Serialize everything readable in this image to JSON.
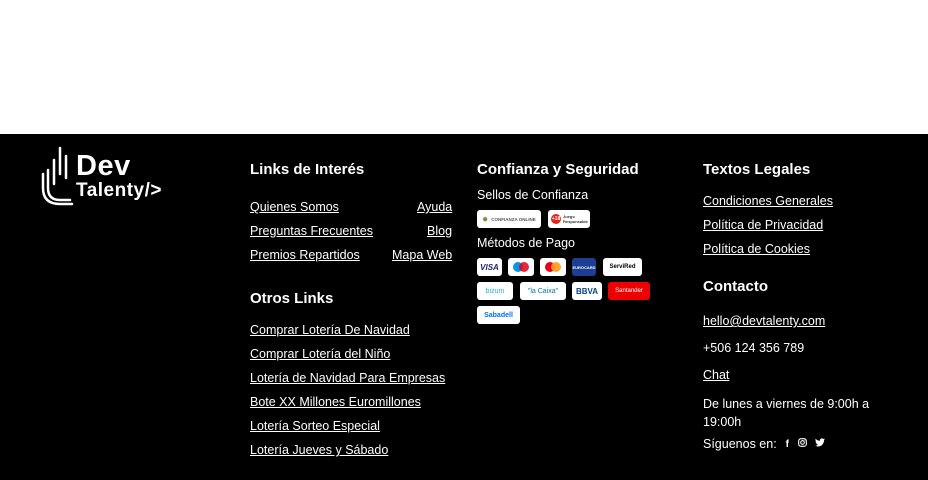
{
  "brand": {
    "line1": "Dev",
    "line2": "Talenty/>"
  },
  "links_interes": {
    "title": "Links de Interés",
    "left": [
      "Quienes Somos",
      "Preguntas Frecuentes",
      "Premios Repartidos"
    ],
    "right": [
      "Ayuda",
      "Blog",
      "Mapa Web"
    ]
  },
  "otros_links": {
    "title": "Otros Links",
    "items": [
      "Comprar Lotería De Navidad",
      "Comprar Lotería del Niño",
      "Lotería de Navidad Para Empresas",
      "Bote XX Millones Euromillones",
      "Lotería Sorteo Especial",
      "Lotería Jueves y Sábado"
    ]
  },
  "confianza": {
    "title": "Confianza y Seguridad",
    "sellos_label": "Sellos de Confianza",
    "sellos": [
      "CONFIANZA ONLINE",
      "Juego Responsable"
    ],
    "pago_label": "Métodos de Pago",
    "pagos": [
      "VISA",
      "Maestro",
      "Mastercard",
      "EUROCARD",
      "ServiRed",
      "bizum",
      "\"la Caixa\"",
      "BBVA",
      "Santander",
      "Sabadell"
    ]
  },
  "legales": {
    "title": "Textos Legales",
    "items": [
      "Condiciones Generales",
      "Política de Privacidad",
      "Política de Cookies"
    ]
  },
  "contacto": {
    "title": "Contacto",
    "email": "hello@devtalenty.com",
    "phone": "+506 124 356 789",
    "chat": "Chat",
    "hours": "De lunes a viernes de 9:00h a 19:00h",
    "follow": "Síguenos en:",
    "social_icons": [
      "facebook-icon",
      "instagram-icon",
      "twitter-icon"
    ]
  },
  "colors": {
    "background": "#000000",
    "text": "#ffffff",
    "santander": "#ec0000",
    "visa": "#1a1f71"
  }
}
